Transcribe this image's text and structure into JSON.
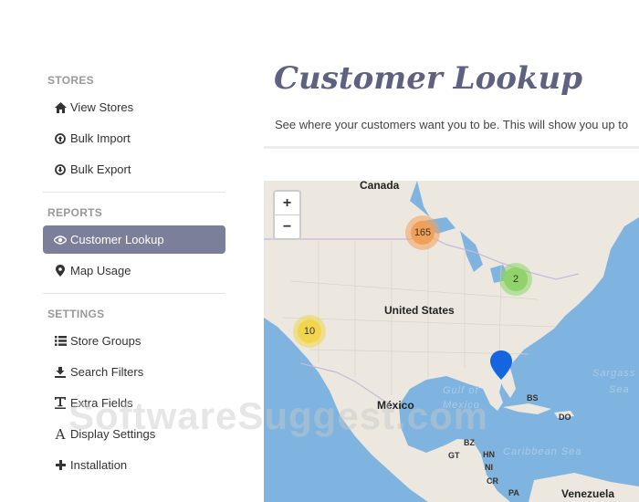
{
  "sidebar": {
    "sections": [
      {
        "title": "STORES",
        "items": [
          {
            "label": "View Stores",
            "icon": "home-icon"
          },
          {
            "label": "Bulk Import",
            "icon": "circle-arrow-up-icon"
          },
          {
            "label": "Bulk Export",
            "icon": "circle-arrow-down-icon"
          }
        ]
      },
      {
        "title": "REPORTS",
        "items": [
          {
            "label": "Customer Lookup",
            "icon": "eye-icon",
            "active": true
          },
          {
            "label": "Map Usage",
            "icon": "map-marker-icon"
          }
        ]
      },
      {
        "title": "SETTINGS",
        "items": [
          {
            "label": "Store Groups",
            "icon": "list-icon"
          },
          {
            "label": "Search Filters",
            "icon": "filter-icon"
          },
          {
            "label": "Extra Fields",
            "icon": "text-field-icon"
          },
          {
            "label": "Display Settings",
            "icon": "font-icon"
          },
          {
            "label": "Installation",
            "icon": "plus-icon"
          }
        ]
      }
    ]
  },
  "main": {
    "title": "Customer Lookup",
    "subtitle": "See where your customers want you to be. This will show you up to"
  },
  "map": {
    "zoom_in": "+",
    "zoom_out": "−",
    "clusters": [
      {
        "count": "165",
        "color": "#f4a15d"
      },
      {
        "count": "2",
        "color": "#8dd36a"
      },
      {
        "count": "10",
        "color": "#f2d64c"
      }
    ],
    "labels": {
      "canada": "Canada",
      "united_states": "United States",
      "mexico": "México",
      "gulf": "Gulf of",
      "gulf2": "Mexico",
      "sargasso": "Sargass",
      "sargasso2": "Sea",
      "caribbean": "Caribbean Sea",
      "venezuela": "Venezuela",
      "bs": "BS",
      "do": "DO",
      "bz": "BZ",
      "gt": "GT",
      "hn": "HN",
      "ni": "NI",
      "cr": "CR",
      "pa": "PA"
    },
    "marker_color": "#1565e0"
  },
  "watermark": "SoftwareSuggest.com"
}
